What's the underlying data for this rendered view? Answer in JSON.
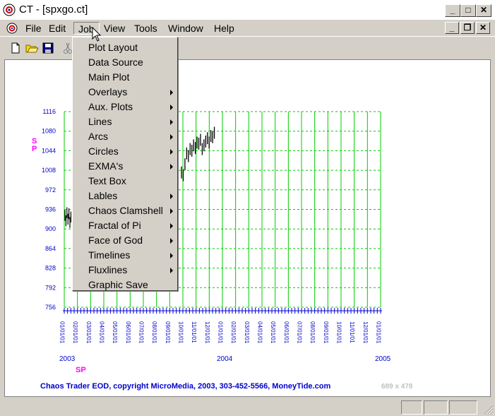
{
  "window": {
    "title": "CT - [spxgo.ct]",
    "controls": {
      "minimize": "_",
      "maximize": "□",
      "close": "✕"
    }
  },
  "menubar": {
    "items": [
      {
        "label": "File"
      },
      {
        "label": "Edit"
      },
      {
        "label": "Job",
        "active": true
      },
      {
        "label": "View"
      },
      {
        "label": "Tools"
      },
      {
        "label": "Window"
      },
      {
        "label": "Help"
      }
    ]
  },
  "mdi_controls": {
    "minimize": "_",
    "restore": "❐",
    "close": "✕"
  },
  "toolbar": {
    "buttons": [
      {
        "icon": "new-file-icon"
      },
      {
        "icon": "open-folder-icon"
      },
      {
        "icon": "save-disk-icon"
      },
      {
        "icon": "cut-scissors-icon"
      }
    ]
  },
  "job_menu": {
    "items": [
      {
        "label": "Plot Layout",
        "submenu": false
      },
      {
        "label": "Data Source",
        "submenu": false
      },
      {
        "label": "Main Plot",
        "submenu": false
      },
      {
        "label": "Overlays",
        "submenu": true
      },
      {
        "label": "Aux. Plots",
        "submenu": true
      },
      {
        "label": "Lines",
        "submenu": true
      },
      {
        "label": "Arcs",
        "submenu": true
      },
      {
        "label": "Circles",
        "submenu": true
      },
      {
        "label": "EXMA's",
        "submenu": true
      },
      {
        "label": "Text Box",
        "submenu": false
      },
      {
        "label": "Lables",
        "submenu": true
      },
      {
        "label": "Chaos Clamshell",
        "submenu": true
      },
      {
        "label": "Fractal of Pi",
        "submenu": true
      },
      {
        "label": "Face of God",
        "submenu": true
      },
      {
        "label": "Timelines",
        "submenu": true
      },
      {
        "label": "Fluxlines",
        "submenu": true
      },
      {
        "label": "Graphic Save",
        "submenu": false
      }
    ]
  },
  "chart_data": {
    "type": "line",
    "symbol_label": "S P",
    "bottom_label": "SP",
    "ylim": [
      756,
      1116
    ],
    "y_ticks": [
      1116,
      1080,
      1044,
      1008,
      972,
      936,
      900,
      864,
      828,
      792,
      756
    ],
    "x_tick_labels": [
      "01/01/01",
      "02/01/01",
      "03/01/01",
      "04/01/01",
      "05/01/01",
      "06/01/01",
      "07/01/01",
      "08/01/01",
      "09/01/01",
      "10/01/01",
      "11/01/01",
      "12/01/01",
      "01/01/01",
      "02/01/01",
      "03/01/01",
      "04/01/01",
      "05/01/01",
      "06/01/01",
      "07/01/01",
      "08/01/01",
      "09/01/01",
      "10/01/01",
      "11/01/01",
      "12/01/01",
      "01/01/01"
    ],
    "year_labels": [
      "2003",
      "2004",
      "2005"
    ],
    "grid": true,
    "grid_color": "#00cc00",
    "series": [
      {
        "values_early": [
          925,
          915,
          930,
          918,
          928,
          912,
          922
        ]
      },
      {
        "values_late": [
          1005,
          1000,
          1020,
          1040,
          1035,
          1048,
          1045,
          1055,
          1050,
          1060,
          1058,
          1065,
          1048,
          1055,
          1062,
          1068,
          1060,
          1072,
          1070,
          1078
        ]
      }
    ],
    "price_color": "#000000",
    "axis_color": "#0000cc",
    "label_color": "#ff00ff"
  },
  "footer": {
    "copyright": "Chaos Trader EOD, copyright MicroMedia, 2003, 303-452-5566, MoneyTide.com",
    "size": "689 x 478"
  }
}
